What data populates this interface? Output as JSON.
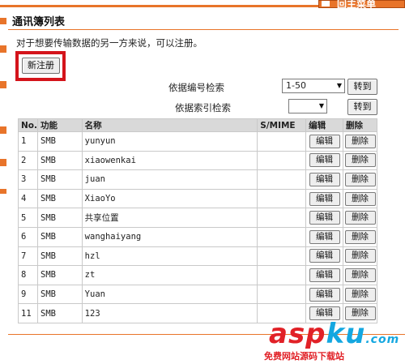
{
  "header": {
    "menu_label": "回主菜单"
  },
  "page": {
    "title": "通讯簿列表",
    "intro": "对于想要传输数据的另一方来说，可以注册。",
    "new_button": "新注册"
  },
  "search": {
    "by_number_label": "依据编号检索",
    "by_number_value": "1-50",
    "by_index_label": "依据索引检索",
    "by_index_value": "",
    "go_label": "转到"
  },
  "table": {
    "headers": [
      "No.",
      "功能",
      "名称",
      "S/MIME",
      "编辑",
      "删除"
    ],
    "edit_label": "编辑",
    "delete_label": "删除",
    "rows": [
      {
        "no": "1",
        "func": "SMB",
        "name": "yunyun",
        "smime": ""
      },
      {
        "no": "2",
        "func": "SMB",
        "name": "xiaowenkai",
        "smime": ""
      },
      {
        "no": "3",
        "func": "SMB",
        "name": "juan",
        "smime": ""
      },
      {
        "no": "4",
        "func": "SMB",
        "name": "XiaoYo",
        "smime": ""
      },
      {
        "no": "5",
        "func": "SMB",
        "name": "共享位置",
        "smime": ""
      },
      {
        "no": "6",
        "func": "SMB",
        "name": "wanghaiyang",
        "smime": ""
      },
      {
        "no": "7",
        "func": "SMB",
        "name": "hzl",
        "smime": ""
      },
      {
        "no": "8",
        "func": "SMB",
        "name": "zt",
        "smime": ""
      },
      {
        "no": "9",
        "func": "SMB",
        "name": "Yuan",
        "smime": ""
      },
      {
        "no": "11",
        "func": "SMB",
        "name": "123",
        "smime": ""
      }
    ]
  },
  "watermark": {
    "brand_a": "asp",
    "brand_b": "ku",
    "brand_c": ".com",
    "tagline": "免费网站源码下载站"
  },
  "colors": {
    "accent": "#e8742a",
    "highlight": "#d4141b",
    "header_bg": "#d9d9d9"
  }
}
